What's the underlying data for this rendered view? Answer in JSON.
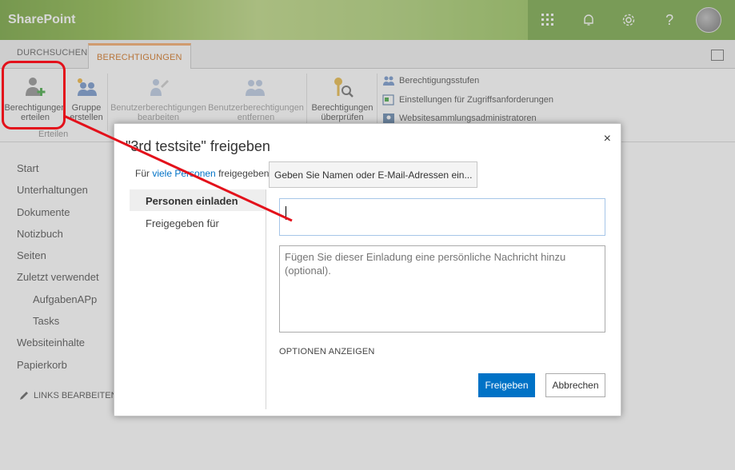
{
  "suitebar": {
    "brand": "SharePoint",
    "icons": [
      "app-launcher-icon",
      "bell-icon",
      "gear-icon",
      "help-icon"
    ],
    "help_glyph": "?"
  },
  "ribbon_tabs": {
    "browse": "DURCHSUCHEN",
    "permissions": "BERECHTIGUNGEN"
  },
  "ribbon": {
    "grant_line1": "Berechtigungen",
    "grant_line2": "erteilen",
    "group_line1": "Gruppe",
    "group_line2": "erstellen",
    "group_label": "Erteilen",
    "edit_line1": "Benutzerberechtigungen",
    "edit_line2": "bearbeiten",
    "remove_line1": "Benutzerberechtigungen",
    "remove_line2": "entfernen",
    "check_line1": "Berechtigungen",
    "check_line2": "überprüfen",
    "levels": "Berechtigungsstufen",
    "access_settings": "Einstellungen für Zugriffsanforderungen",
    "site_admins": "Websitesammlungsadministratoren"
  },
  "leftnav": {
    "items": [
      "Start",
      "Unterhaltungen",
      "Dokumente",
      "Notizbuch",
      "Seiten",
      "Zuletzt verwendet",
      "AufgabenAPp",
      "Tasks",
      "Websiteinhalte",
      "Papierkorb"
    ],
    "edit_links": "LINKS BEARBEITEN"
  },
  "dialog": {
    "title": "\"3rd testsite\" freigeben",
    "close": "×",
    "sub_prefix": "Für ",
    "sub_link": "viele Personen",
    "sub_suffix": " freigegeben",
    "names_button": "Geben Sie Namen oder E-Mail-Adressen ein...",
    "nav": [
      "Personen einladen",
      "Freigegeben für"
    ],
    "message_placeholder": "Fügen Sie dieser Einladung eine persönliche Nachricht hinzu (optional).",
    "options": "OPTIONEN ANZEIGEN",
    "share": "Freigeben",
    "cancel": "Abbrechen"
  },
  "colors": {
    "accent": "#0072c6",
    "tab_active": "#d06a10",
    "annotation": "#e3111b"
  }
}
